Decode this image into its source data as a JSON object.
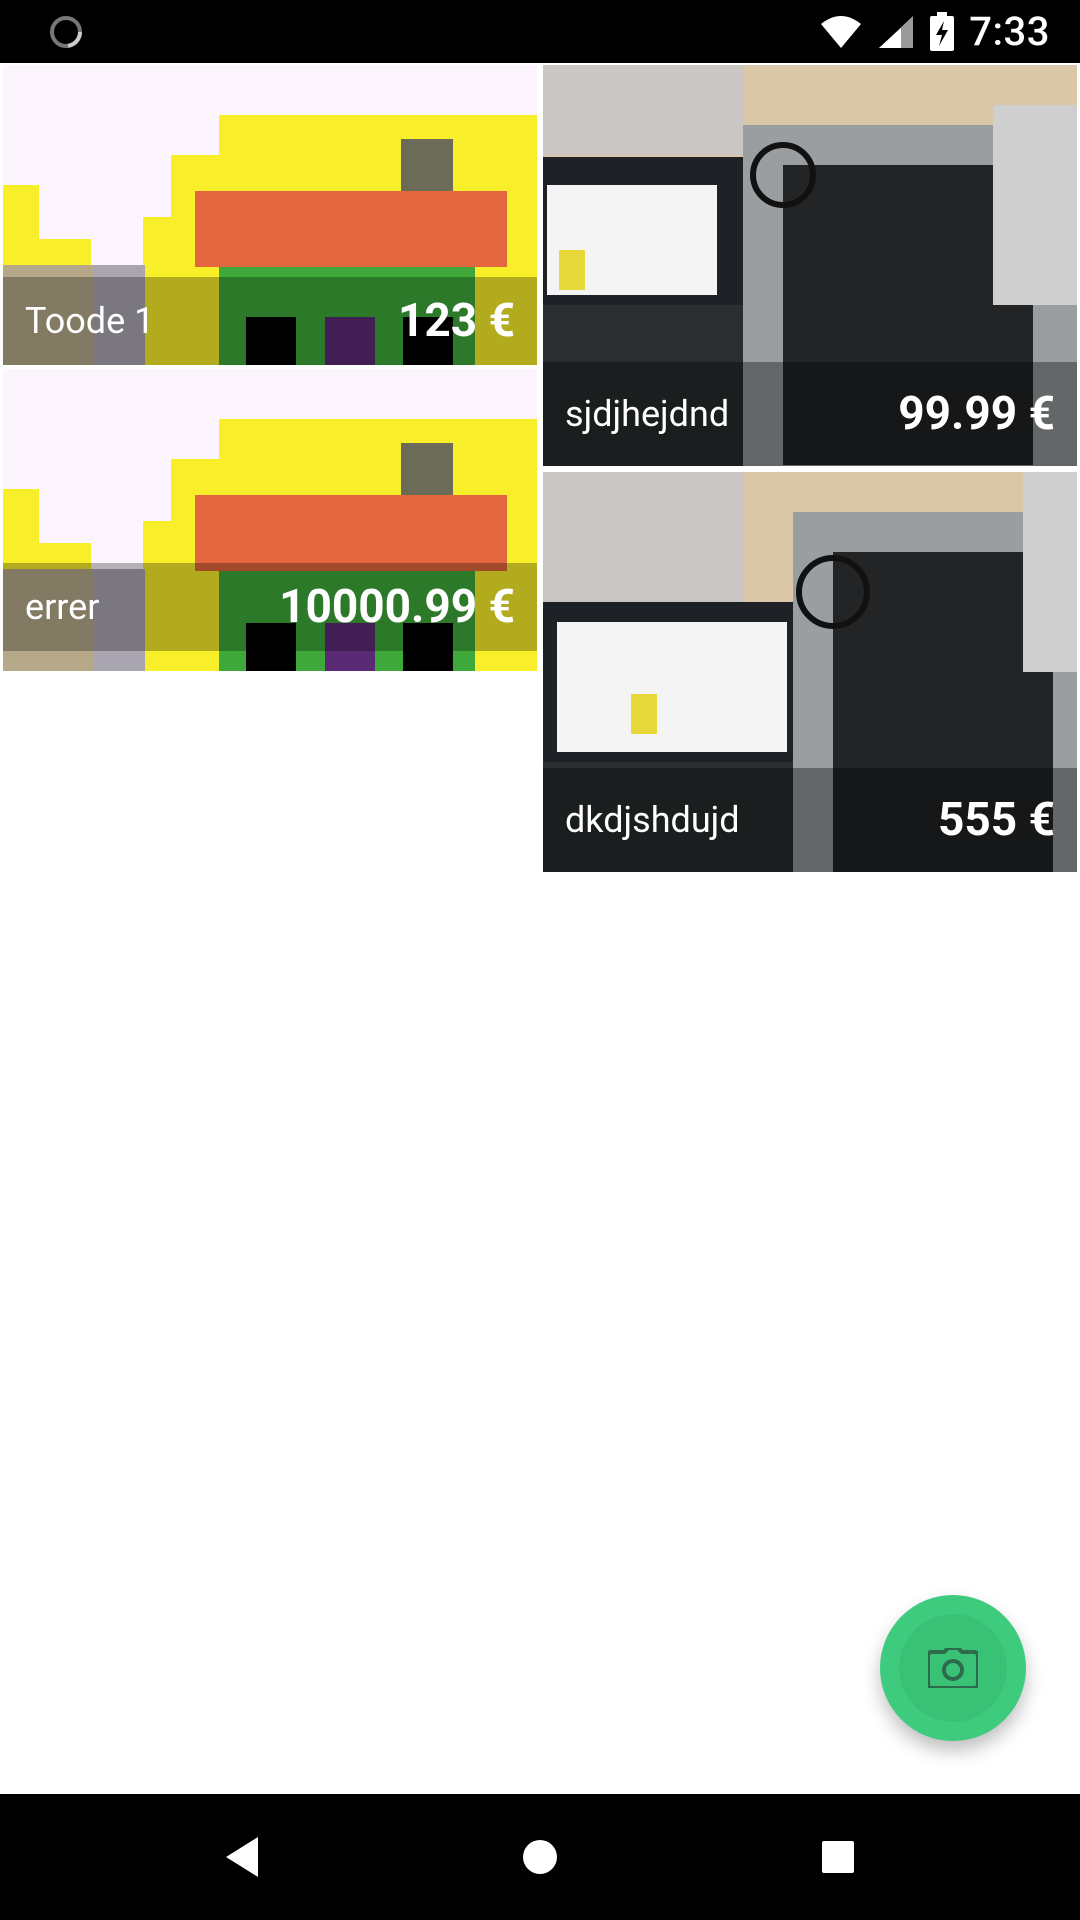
{
  "status_bar": {
    "time": "7:33",
    "icons": [
      "loading-spinner-icon",
      "wifi-icon",
      "signal-icon",
      "battery-charging-icon"
    ]
  },
  "products": [
    {
      "name": "Toode 1",
      "price": "123 €",
      "image": "pixel-house"
    },
    {
      "name": "sjdjhejdnd",
      "price": "99.99 €",
      "image": "laptop-photo"
    },
    {
      "name": "errer",
      "price": "10000.99 €",
      "image": "pixel-house"
    },
    {
      "name": "dkdjshdujd",
      "price": "555 €",
      "image": "laptop-photo"
    }
  ],
  "fab": {
    "icon": "camera-icon"
  },
  "nav_bar": {
    "icons": [
      "back-icon",
      "home-icon",
      "recents-icon"
    ]
  },
  "colors": {
    "accent": "#3ecb7e",
    "overlay": "rgba(0,0,0,0.35)"
  }
}
